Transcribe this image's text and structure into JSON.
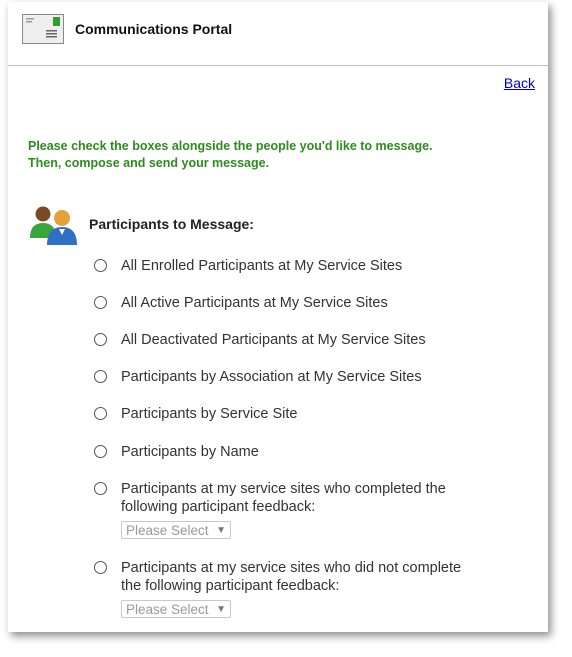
{
  "header": {
    "title": "Communications Portal",
    "icon": "envelope-icon"
  },
  "nav": {
    "back_label": "Back"
  },
  "instructions": "Please check the boxes alongside the people you'd like to message. Then, compose and send your message.",
  "participants": {
    "section_label": "Participants to Message:",
    "icon": "people-icon",
    "options": [
      {
        "label": "All Enrolled Participants at My Service Sites"
      },
      {
        "label": "All Active Participants at My Service Sites"
      },
      {
        "label": "All Deactivated Participants at My Service Sites"
      },
      {
        "label": "Participants by Association at My Service Sites"
      },
      {
        "label": "Participants by Service Site"
      },
      {
        "label": "Participants by Name"
      },
      {
        "label": "Participants at my service sites who completed the following participant feedback:",
        "select_value": "Please Select"
      },
      {
        "label": "Participants at my service sites who did not complete the following participant feedback:",
        "select_value": "Please Select"
      }
    ]
  },
  "colors": {
    "instructions": "#2e8b1e",
    "link": "#0000cc"
  }
}
